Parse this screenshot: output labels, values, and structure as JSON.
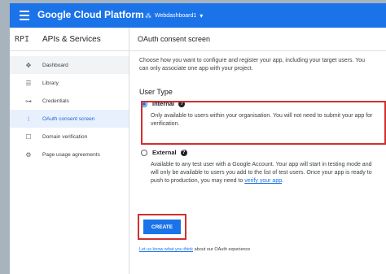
{
  "topbar": {
    "brand": "Google Cloud Platform",
    "project": "Webdashboard1"
  },
  "sidebar": {
    "api_badge": "RPI",
    "title": "APIs & Services",
    "items": [
      {
        "label": "Dashboard",
        "icon": "dashboard-icon"
      },
      {
        "label": "Library",
        "icon": "library-icon"
      },
      {
        "label": "Credentials",
        "icon": "key-icon"
      },
      {
        "label": "OAuth consent screen",
        "icon": "consent-icon",
        "active": true
      },
      {
        "label": "Domain verification",
        "icon": "domain-icon"
      },
      {
        "label": "Page usage agreements",
        "icon": "settings-icon"
      }
    ]
  },
  "main": {
    "title": "OAuth consent screen",
    "intro": "Choose how you want to configure and register your app, including your target users. You can only associate one app with your project.",
    "user_type_heading": "User Type",
    "internal": {
      "label": "Internal",
      "description": "Only available to users within your organisation. You will not need to submit your app for verification."
    },
    "external": {
      "label": "External",
      "description": "Available to any test user with a Google Account. Your app will start in testing mode and will only be available to users you add to the list of test users. Once your app is ready to push to production, you may need to",
      "link": "verify your app",
      "link_suffix": "."
    },
    "create_label": "CREATE",
    "footer_link": "Let us know what you think",
    "footer_text": " about our OAuth experience"
  },
  "colors": {
    "accent": "#1a73e8",
    "highlight": "#d32f2f",
    "active_bg": "#e8f0fe"
  }
}
